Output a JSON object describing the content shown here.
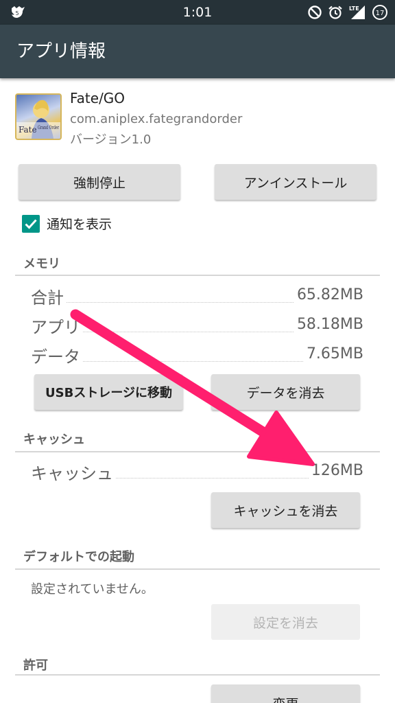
{
  "status_bar": {
    "time": "1:01",
    "notification_count": "5",
    "network": "LTE",
    "battery_level": "17"
  },
  "app_bar": {
    "title": "アプリ情報"
  },
  "app": {
    "name": "Fate/GO",
    "package": "com.aniplex.fategrandorder",
    "version": "バージョン1.0",
    "icon_text_1": "Fate",
    "icon_text_2": "Grand Order"
  },
  "actions": {
    "force_stop": "強制停止",
    "uninstall": "アンインストール"
  },
  "notifications": {
    "label": "通知を表示",
    "checked": true
  },
  "memory": {
    "header": "メモリ",
    "rows": [
      {
        "label": "合計",
        "value": "65.82MB"
      },
      {
        "label": "アプリ",
        "value": "58.18MB"
      },
      {
        "label": "データ",
        "value": "7.65MB"
      }
    ],
    "move_usb": "USBストレージに移動",
    "clear_data": "データを消去"
  },
  "cache": {
    "header": "キャッシュ",
    "label": "キャッシュ",
    "value": "126MB",
    "clear_cache": "キャッシュを消去"
  },
  "defaults": {
    "header": "デフォルトでの起動",
    "status": "設定されていません。",
    "clear_defaults": "設定を消去"
  },
  "permissions": {
    "header": "許可",
    "change": "変更"
  },
  "colors": {
    "status_bar": "#263238",
    "app_bar": "#37474f",
    "accent": "#009688",
    "annotation_arrow": "#ff1f6e"
  }
}
